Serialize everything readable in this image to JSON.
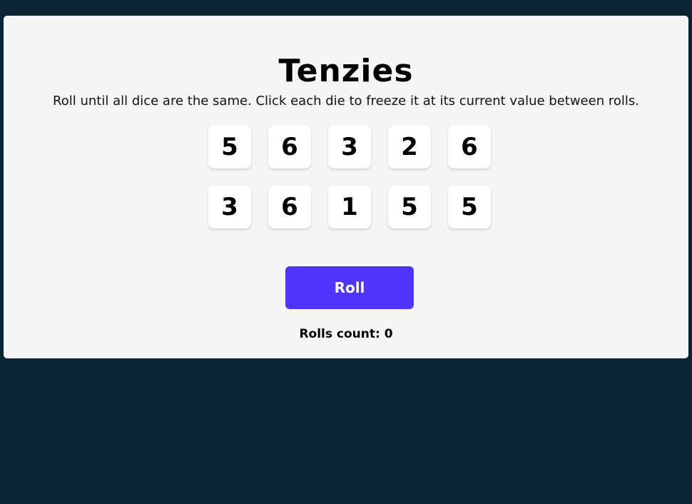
{
  "game": {
    "title": "Tenzies",
    "instructions": "Roll until all dice are the same. Click each die to freeze it at its current value between rolls.",
    "dice": [
      "5",
      "6",
      "3",
      "2",
      "6",
      "3",
      "6",
      "1",
      "5",
      "5"
    ],
    "roll_label": "Roll",
    "rolls_count_text": "Rolls count: 0"
  },
  "colors": {
    "background": "#0b2434",
    "board": "#f5f5f5",
    "die": "#ffffff",
    "accent": "#5035ff"
  }
}
